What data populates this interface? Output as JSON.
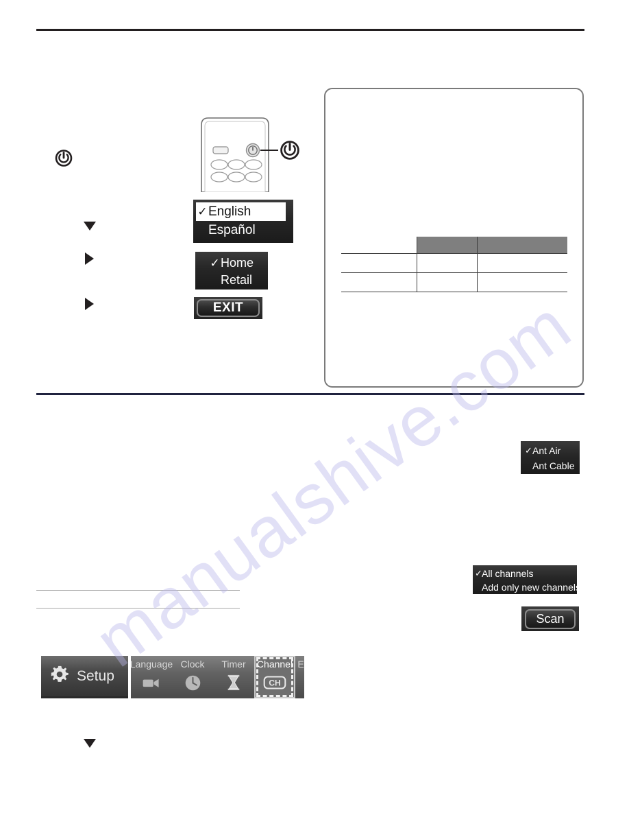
{
  "page": {
    "watermark": "manualshive.com"
  },
  "dividers": {
    "top_rule": "page-top-rule",
    "middle_rule": "section-divider-rule",
    "note_rule_1": "thin-rule-1",
    "note_rule_2": "thin-rule-2"
  },
  "margin_markers": {
    "power": {
      "icon": "power-icon"
    },
    "step_markers": [
      {
        "icon": "triangle-down-icon"
      },
      {
        "icon": "triangle-right-icon"
      },
      {
        "icon": "triangle-right-icon"
      },
      {
        "icon": "triangle-down-icon"
      }
    ]
  },
  "remote": {
    "name": "remote-control-illustration",
    "callout_icon": "power-icon",
    "highlighted_button": "power-button"
  },
  "note_box": {
    "table": {
      "columns": 3,
      "body_rows": 2,
      "header_spans_columns": [
        2,
        3
      ],
      "header_fill": "#7f7f7f",
      "cells": [
        [
          "",
          "",
          ""
        ],
        [
          "",
          "",
          ""
        ]
      ],
      "headers": [
        "",
        "",
        ""
      ]
    }
  },
  "osd": {
    "language_menu": {
      "name": "language-menu",
      "items": [
        {
          "label": "English",
          "checked": true,
          "highlighted": true
        },
        {
          "label": "Español",
          "checked": false,
          "highlighted": false
        }
      ]
    },
    "location_menu": {
      "name": "location-menu",
      "items": [
        {
          "label": "Home",
          "checked": true,
          "highlighted": false
        },
        {
          "label": "Retail",
          "checked": false,
          "highlighted": false
        }
      ]
    },
    "antenna_menu": {
      "name": "antenna-source-menu",
      "items": [
        {
          "label": "Ant Air",
          "checked": true,
          "highlighted": false
        },
        {
          "label": "Ant Cable",
          "checked": false,
          "highlighted": false
        }
      ]
    },
    "scan_mode_menu": {
      "name": "channel-scan-mode-menu",
      "items": [
        {
          "label": "All channels",
          "checked": true,
          "highlighted": false
        },
        {
          "label": "Add only new channels",
          "checked": false,
          "highlighted": false
        }
      ]
    },
    "exit_button": {
      "label": "EXIT"
    },
    "scan_button": {
      "label": "Scan"
    },
    "check_glyph": "✓"
  },
  "setup_bar": {
    "title": "Setup",
    "title_icon": "gear-icon",
    "items": [
      {
        "label": "Language",
        "icon": "camcorder-icon",
        "active": false
      },
      {
        "label": "Clock",
        "icon": "clock-icon",
        "active": false
      },
      {
        "label": "Timer",
        "icon": "hourglass-icon",
        "active": false
      },
      {
        "label": "Channel",
        "icon": "ch-icon",
        "active": true
      },
      {
        "label": "E",
        "icon": "",
        "active": false
      }
    ]
  },
  "colors": {
    "rule_dark": "#231f20",
    "rule_navy": "#20233f",
    "rule_thin": "#a8a8a8",
    "osd_dark": "#262626",
    "osd_text": "#ffffff",
    "table_header": "#7f7f7f",
    "watermark": "#b9b6ea",
    "note_border": "#7a7a7a"
  }
}
